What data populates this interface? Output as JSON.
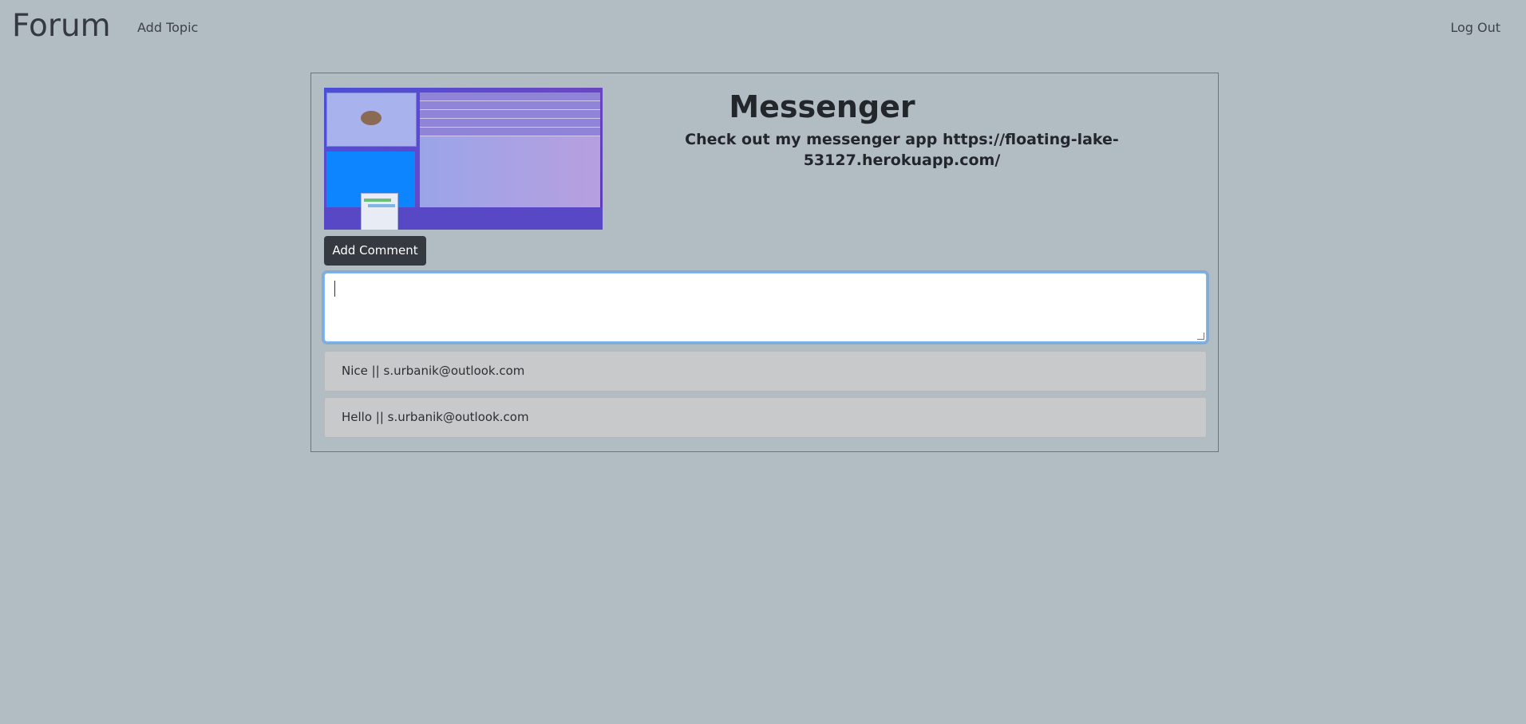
{
  "navbar": {
    "brand": "Forum",
    "add_topic": "Add Topic",
    "logout": "Log Out"
  },
  "topic": {
    "title": "Messenger",
    "description": "Check out my messenger app https://floating-lake-53127.herokuapp.com/"
  },
  "add_comment_label": "Add Comment",
  "comment_input": {
    "value": "",
    "placeholder": ""
  },
  "comments": [
    {
      "text": "Nice || s.urbanik@outlook.com"
    },
    {
      "text": "Hello || s.urbanik@outlook.com"
    }
  ],
  "colors": {
    "page_background": "#b1bcc3",
    "button_dark": "#343a40",
    "focus_border": "#80bdff",
    "comment_background": "#c8c9ca"
  }
}
